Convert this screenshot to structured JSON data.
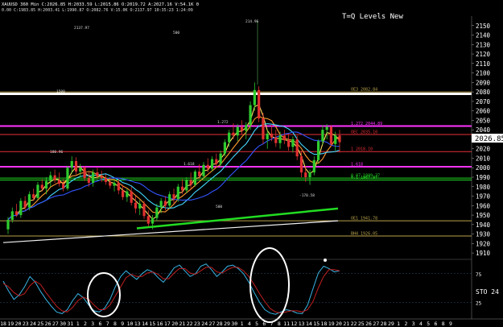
{
  "header": {
    "symbol_line": "XAUUSD 360 Min  C:2026.85  H:2033.59  L:2015.86  O:2019.72  A:2027.16  V:54.1K  0",
    "sub_line": "0.00 C:1983.85 H:2003.41 L:1990.87 O:2082.76 V:15.0K  O:2137.97 10:35:23 1:24:09",
    "title": "T=Q Levels New"
  },
  "colors": {
    "background": "#000000",
    "candle_up": "#2ecc2e",
    "candle_down": "#e03030",
    "level_white": "#ffffff",
    "level_magenta": "#ff33ff",
    "level_red": "#e8303a",
    "level_green": "#22dd22",
    "level_olive": "#b8a24a",
    "ma_blue": "#3355ff",
    "ma_cyan": "#44d8ff",
    "ma_orange": "#ff9a30",
    "ma_yellow": "#ffe060",
    "ma_white": "#f2f2f2",
    "stoch_k": "#38b6e6",
    "stoch_d": "#c02020",
    "price_tag_bg": "#ffffff"
  },
  "chart_data": [
    {
      "type": "candlestick",
      "ylim": [
        1905,
        2160
      ],
      "y_ticks": [
        1910,
        1920,
        1930,
        1940,
        1950,
        1960,
        1970,
        1980,
        1990,
        2000,
        2010,
        2020,
        2030,
        2040,
        2050,
        2060,
        2070,
        2080,
        2090,
        2100,
        2110,
        2120,
        2130,
        2140,
        2150
      ],
      "last_price": "2026.85",
      "ohlc_approx": [
        [
          1935,
          1948,
          1930,
          1945
        ],
        [
          1945,
          1958,
          1942,
          1954
        ],
        [
          1954,
          1962,
          1948,
          1950
        ],
        [
          1950,
          1968,
          1947,
          1965
        ],
        [
          1965,
          1970,
          1955,
          1958
        ],
        [
          1958,
          1975,
          1955,
          1972
        ],
        [
          1972,
          1978,
          1965,
          1968
        ],
        [
          1968,
          1985,
          1966,
          1982
        ],
        [
          1982,
          1988,
          1975,
          1978
        ],
        [
          1978,
          1990,
          1972,
          1986
        ],
        [
          1986,
          1996,
          1980,
          1992
        ],
        [
          1992,
          1998,
          1984,
          1987
        ],
        [
          1987,
          1995,
          1980,
          1983
        ],
        [
          1983,
          1988,
          1975,
          1978
        ],
        [
          1978,
          2002,
          1976,
          2000
        ],
        [
          2000,
          2012,
          1994,
          2007
        ],
        [
          2007,
          2011,
          1993,
          1996
        ],
        [
          1996,
          2004,
          1990,
          2000
        ],
        [
          2000,
          2002,
          1986,
          1989
        ],
        [
          1989,
          1995,
          1980,
          1984
        ],
        [
          1984,
          1998,
          1980,
          1995
        ],
        [
          1995,
          2000,
          1988,
          1991
        ],
        [
          1991,
          1997,
          1985,
          1989
        ],
        [
          1989,
          1993,
          1982,
          1985
        ],
        [
          1985,
          1990,
          1978,
          1981
        ],
        [
          1981,
          1987,
          1975,
          1984
        ],
        [
          1984,
          1988,
          1972,
          1976
        ],
        [
          1976,
          1982,
          1966,
          1969
        ],
        [
          1969,
          1978,
          1964,
          1975
        ],
        [
          1975,
          1980,
          1960,
          1963
        ],
        [
          1963,
          1970,
          1952,
          1957
        ],
        [
          1957,
          1966,
          1950,
          1962
        ],
        [
          1962,
          1965,
          1946,
          1949
        ],
        [
          1949,
          1955,
          1938,
          1941
        ],
        [
          1941,
          1950,
          1935,
          1947
        ],
        [
          1947,
          1962,
          1944,
          1958
        ],
        [
          1958,
          1968,
          1952,
          1965
        ],
        [
          1965,
          1970,
          1955,
          1960
        ],
        [
          1960,
          1975,
          1957,
          1972
        ],
        [
          1972,
          1978,
          1962,
          1967
        ],
        [
          1967,
          1983,
          1964,
          1980
        ],
        [
          1980,
          1988,
          1972,
          1976
        ],
        [
          1976,
          1990,
          1973,
          1987
        ],
        [
          1987,
          1995,
          1978,
          1982
        ],
        [
          1982,
          1998,
          1980,
          1996
        ],
        [
          1996,
          2004,
          1988,
          1991
        ],
        [
          1991,
          2006,
          1988,
          2003
        ],
        [
          2003,
          2010,
          1995,
          1999
        ],
        [
          1999,
          2012,
          1996,
          2009
        ],
        [
          2009,
          2015,
          2000,
          2004
        ],
        [
          2004,
          2018,
          2001,
          2015
        ],
        [
          2015,
          2030,
          2012,
          2027
        ],
        [
          2027,
          2040,
          2022,
          2037
        ],
        [
          2037,
          2047,
          2030,
          2034
        ],
        [
          2034,
          2046,
          2028,
          2043
        ],
        [
          2043,
          2050,
          2035,
          2039
        ],
        [
          2039,
          2048,
          2030,
          2045
        ],
        [
          2045,
          2070,
          2040,
          2066
        ],
        [
          2066,
          2090,
          2060,
          2082
        ],
        [
          2082,
          2086,
          2048,
          2052
        ],
        [
          2052,
          2058,
          2025,
          2030
        ],
        [
          2030,
          2040,
          2020,
          2036
        ],
        [
          2036,
          2045,
          2028,
          2032
        ],
        [
          2032,
          2040,
          2022,
          2026
        ],
        [
          2026,
          2038,
          2020,
          2034
        ],
        [
          2034,
          2040,
          2025,
          2029
        ],
        [
          2029,
          2036,
          2018,
          2022
        ],
        [
          2022,
          2033,
          2016,
          2030
        ],
        [
          2030,
          2034,
          2008,
          2012
        ],
        [
          2012,
          2018,
          1990,
          1995
        ],
        [
          1995,
          2002,
          1985,
          1990
        ],
        [
          1990,
          1998,
          1982,
          1995
        ],
        [
          1995,
          2012,
          1992,
          2008
        ],
        [
          2008,
          2030,
          2005,
          2028
        ],
        [
          2028,
          2045,
          2024,
          2040
        ],
        [
          2040,
          2046,
          2030,
          2043
        ],
        [
          2043,
          2045,
          2022,
          2025
        ],
        [
          2025,
          2038,
          2018,
          2034
        ],
        [
          2034,
          2040,
          2016,
          2027
        ]
      ],
      "levels": [
        {
          "price": 2078,
          "color": "level_white",
          "width": 3,
          "label": ""
        },
        {
          "price": 2080,
          "color": "level_olive",
          "width": 1,
          "label": "OE3  2082.84"
        },
        {
          "price": 2044,
          "color": "level_magenta",
          "width": 2,
          "label": "1.272   2044.89"
        },
        {
          "price": 2035,
          "color": "level_red",
          "width": 1,
          "label": "OEC  2035.10"
        },
        {
          "price": 2017,
          "color": "level_red",
          "width": 1,
          "label": "1  2018.10"
        },
        {
          "price": 2001,
          "color": "level_magenta",
          "width": 2,
          "label": "1.618"
        },
        {
          "price": 1989,
          "color": "level_green",
          "width": 1,
          "label": "0.07  1989.37"
        },
        {
          "price": 1987,
          "color": "level_green",
          "width": 1,
          "label": "0.1  1987.97"
        },
        {
          "price": 1944,
          "color": "level_olive",
          "width": 1,
          "label": "OE1  1941.78"
        },
        {
          "price": 1928,
          "color": "level_olive",
          "width": 1,
          "label": "BH4  1926.05"
        }
      ],
      "annotations": [
        "2137.97",
        "214.96",
        "500",
        "1500",
        "1.272",
        "1.618",
        "180.96",
        "-170.58",
        "500"
      ]
    },
    {
      "type": "line",
      "title": "STO",
      "readout": "STO  24",
      "ylim": [
        0,
        100
      ],
      "y_ticks": [
        25,
        75
      ],
      "series": [
        {
          "name": "K",
          "values": [
            62,
            45,
            30,
            38,
            52,
            70,
            60,
            44,
            30,
            18,
            8,
            5,
            12,
            28,
            40,
            33,
            20,
            10,
            8,
            15,
            30,
            52,
            70,
            80,
            72,
            65,
            75,
            82,
            78,
            68,
            60,
            72,
            85,
            90,
            80,
            70,
            75,
            88,
            92,
            82,
            70,
            78,
            88,
            90,
            84,
            75,
            60,
            42,
            25,
            12,
            6,
            4,
            8,
            12,
            10,
            6,
            5,
            20,
            48,
            76,
            88,
            84,
            78,
            80
          ]
        },
        {
          "name": "D",
          "values": [
            58,
            52,
            42,
            36,
            40,
            54,
            62,
            56,
            42,
            30,
            18,
            10,
            8,
            16,
            28,
            34,
            30,
            20,
            12,
            12,
            20,
            36,
            52,
            68,
            74,
            70,
            70,
            76,
            78,
            74,
            66,
            66,
            76,
            84,
            84,
            76,
            74,
            80,
            86,
            86,
            78,
            76,
            82,
            86,
            86,
            80,
            70,
            56,
            40,
            26,
            14,
            8,
            6,
            8,
            10,
            10,
            8,
            12,
            26,
            50,
            70,
            82,
            82,
            80
          ]
        }
      ]
    }
  ],
  "x_axis": {
    "labels": [
      "18",
      "19",
      "20",
      "23",
      "24",
      "25",
      "26",
      "27",
      "30",
      "31",
      "1",
      "2",
      "3",
      "6",
      "7",
      "8",
      "9",
      "10",
      "13",
      "14",
      "15",
      "16",
      "17",
      "20",
      "21",
      "22",
      "23",
      "24",
      "27",
      "28",
      "29",
      "30",
      "1",
      "4",
      "5",
      "6",
      "7",
      "8",
      "11",
      "12",
      "13",
      "14",
      "15",
      "18",
      "19",
      "20",
      "21",
      "22",
      "25",
      "26",
      "27",
      "28",
      "29",
      "1",
      "2",
      "3",
      "4",
      "5",
      "6",
      "8",
      "9"
    ]
  }
}
